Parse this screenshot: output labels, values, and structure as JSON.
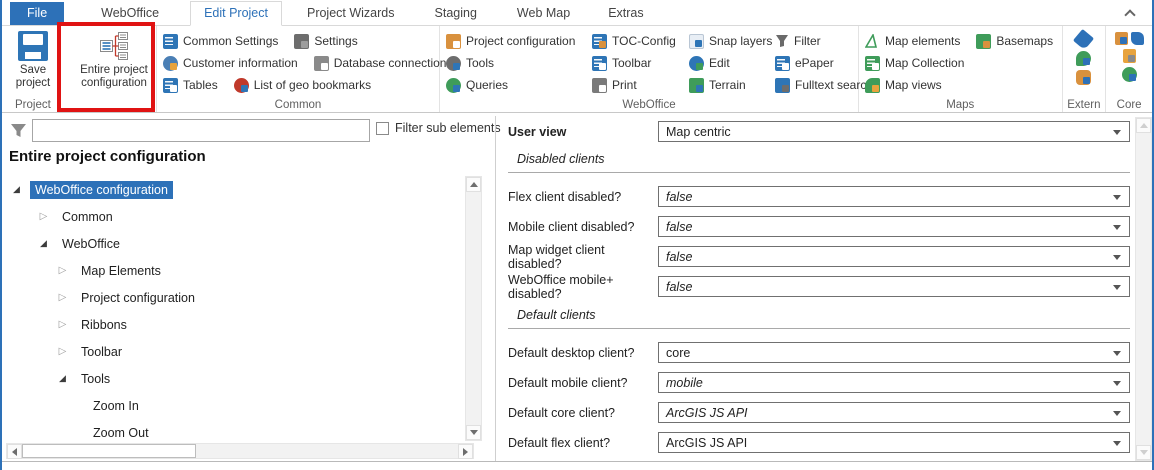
{
  "colors": {
    "accent_blue": "#2d71b8",
    "highlight_red": "#e01313",
    "selection_blue": "#2d71b8",
    "ribbon_label_gray": "#5f5f5f"
  },
  "tabs": {
    "file": "File",
    "items": [
      "WebOffice",
      "Edit Project",
      "Project Wizards",
      "Staging",
      "Web Map",
      "Extras"
    ],
    "active": "Edit Project"
  },
  "ribbon": {
    "project": {
      "label": "Project",
      "save": "Save project",
      "entire": "Entire project configuration"
    },
    "common": {
      "label": "Common",
      "r1": [
        "Common Settings",
        "Settings"
      ],
      "r2": [
        "Customer information",
        "Database connections"
      ],
      "r3": [
        "Tables",
        "List of geo bookmarks"
      ]
    },
    "weboffice": {
      "label": "WebOffice",
      "c1": [
        "Project configuration",
        "Tools",
        "Queries"
      ],
      "c2": [
        "TOC-Config",
        "Toolbar",
        "Print"
      ],
      "c3": [
        "Snap layers",
        "Edit",
        "Terrain"
      ],
      "c4": [
        "Filter",
        "ePaper",
        "Fulltext search"
      ]
    },
    "maps": {
      "label": "Maps",
      "r1": [
        "Map elements",
        "Basemaps"
      ],
      "r2": "Map Collection",
      "r3": "Map views"
    },
    "extern": {
      "label": "Extern"
    },
    "core": {
      "label": "Core"
    }
  },
  "icons": {
    "collapse-ribbon": "chevron-up",
    "save-project": "blue floppy disk",
    "entire-project-configuration": "document tree diagram with red connectors",
    "filter-funnel": "gray funnel",
    "tree-expanded": "black lower-right triangle",
    "tree-collapsed": "gray outline right triangle",
    "combo-arrow": "small down triangle"
  },
  "left": {
    "filter_checkbox": "Filter sub elements",
    "title": "Entire project configuration",
    "tree": [
      {
        "label": "WebOffice configuration",
        "level": 0,
        "state": "expanded",
        "selected": true
      },
      {
        "label": "Common",
        "level": 1,
        "state": "collapsed"
      },
      {
        "label": "WebOffice",
        "level": 1,
        "state": "expanded"
      },
      {
        "label": "Map Elements",
        "level": 2,
        "state": "collapsed"
      },
      {
        "label": "Project configuration",
        "level": 2,
        "state": "collapsed"
      },
      {
        "label": "Ribbons",
        "level": 2,
        "state": "collapsed"
      },
      {
        "label": "Toolbar",
        "level": 2,
        "state": "collapsed"
      },
      {
        "label": "Tools",
        "level": 2,
        "state": "expanded"
      },
      {
        "label": "Zoom In",
        "level": 3,
        "state": "leaf"
      },
      {
        "label": "Zoom Out",
        "level": 3,
        "state": "leaf"
      }
    ]
  },
  "form": {
    "user_view": {
      "label": "User view",
      "value": "Map centric"
    },
    "section_disabled": "Disabled clients",
    "flex": {
      "label": "Flex client disabled?",
      "value": "false"
    },
    "mobile": {
      "label": "Mobile client disabled?",
      "value": "false"
    },
    "widget": {
      "label": "Map widget client disabled?",
      "value": "false"
    },
    "mobileplus": {
      "label": "WebOffice mobile+ disabled?",
      "value": "false"
    },
    "section_default": "Default clients",
    "desktop": {
      "label": "Default desktop client?",
      "value": "core"
    },
    "def_mobile": {
      "label": "Default mobile client?",
      "value": "mobile"
    },
    "def_core": {
      "label": "Default core client?",
      "value": "ArcGIS JS API"
    },
    "def_flex": {
      "label": "Default flex client?",
      "value": "ArcGIS JS API"
    }
  }
}
